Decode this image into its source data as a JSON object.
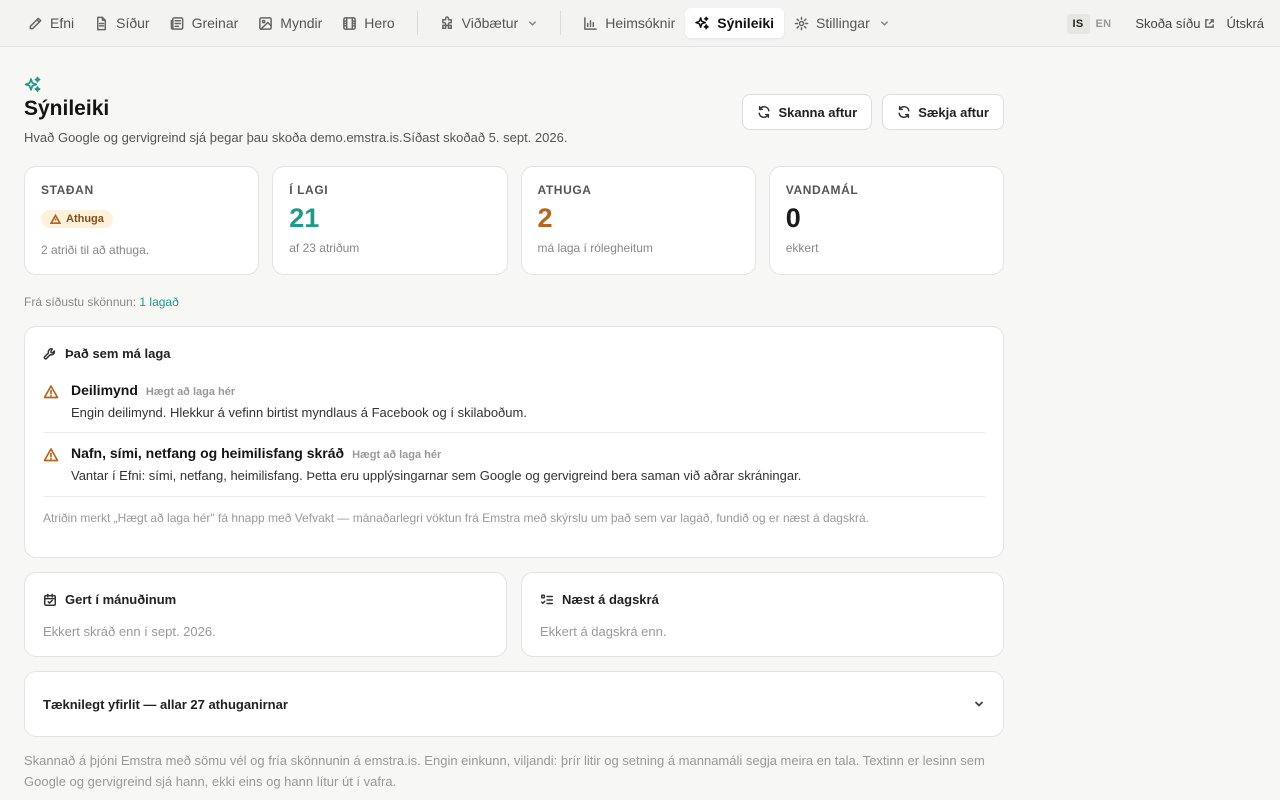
{
  "nav": {
    "items": [
      {
        "label": "Efni"
      },
      {
        "label": "Síður"
      },
      {
        "label": "Greinar"
      },
      {
        "label": "Myndir"
      },
      {
        "label": "Hero"
      },
      {
        "label": "Viðbætur"
      },
      {
        "label": "Heimsóknir"
      },
      {
        "label": "Sýnileiki"
      },
      {
        "label": "Stillingar"
      }
    ],
    "active": "Sýnileiki",
    "lang": {
      "is": "IS",
      "en": "EN",
      "active": "IS"
    },
    "view_site": "Skoða síðu",
    "logout": "Útskrá"
  },
  "header": {
    "title": "Sýnileiki",
    "subtitle": "Hvað Google og gervigreind sjá þegar þau skoða demo.emstra.is.Síðast skoðað 5. sept. 2026.",
    "rescan_label": "Skanna aftur",
    "refetch_label": "Sækja aftur"
  },
  "stats": {
    "status": {
      "label": "STAÐAN",
      "badge": "Athuga",
      "note": "2 atriði til að athuga."
    },
    "ok": {
      "label": "Í LAGI",
      "value": "21",
      "note": "af 23 atriðum"
    },
    "warn": {
      "label": "ATHUGA",
      "value": "2",
      "note": "má laga í rólegheitum"
    },
    "problems": {
      "label": "VANDAMÁL",
      "value": "0",
      "note": "ekkert"
    }
  },
  "since_last_scan": {
    "prefix": "Frá síðustu skönnun:",
    "link": "1 lagað"
  },
  "fix_panel": {
    "title": "Það sem má laga",
    "items": [
      {
        "title": "Deilimynd",
        "tag": "Hægt að laga hér",
        "desc": "Engin deilimynd. Hlekkur á vefinn birtist myndlaus á Facebook og í skilaboðum."
      },
      {
        "title": "Nafn, sími, netfang og heimilisfang skráð",
        "tag": "Hægt að laga hér",
        "desc": "Vantar í Efni: sími, netfang, heimilisfang. Þetta eru upplýsingarnar sem Google og gervigreind bera saman við aðrar skráningar."
      }
    ],
    "footnote": "Atriðin merkt „Hægt að laga hér\" fá hnapp með Vefvakt — mánaðarlegri vöktun frá Emstra með skýrslu um það sem var lagað, fundið og er næst á dagskrá."
  },
  "done_panel": {
    "title": "Gert í mánuðinum",
    "note": "Ekkert skráð enn í sept. 2026."
  },
  "next_panel": {
    "title": "Næst á dagskrá",
    "note": "Ekkert á dagskrá enn."
  },
  "tech_panel": {
    "title": "Tæknilegt yfirlit — allar 27 athuganirnar"
  },
  "footer_note": "Skannað á þjóni Emstra með sömu vél og fría skönnunin á emstra.is. Engin einkunn, viljandi: þrír litir og setning á mannamáli segja meira en tala. Textinn er lesinn sem Google og gervigreind sjá hann, ekki eins og hann lítur út í vafra.",
  "colors": {
    "accent": "#1e9a8a",
    "warning": "#b5651d",
    "badge_bg": "#fdf1dc"
  }
}
